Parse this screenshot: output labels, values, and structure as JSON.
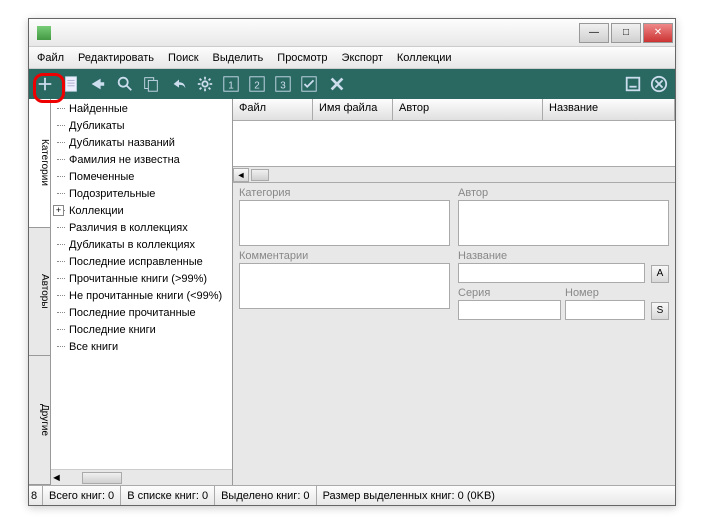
{
  "menubar": [
    "Файл",
    "Редактировать",
    "Поиск",
    "Выделить",
    "Просмотр",
    "Экспорт",
    "Коллекции"
  ],
  "sidetabs": [
    "Категории",
    "Авторы",
    "Другие"
  ],
  "tree": [
    {
      "label": "Найденные",
      "expandable": false
    },
    {
      "label": "Дубликаты",
      "expandable": false
    },
    {
      "label": "Дубликаты названий",
      "expandable": false
    },
    {
      "label": "Фамилия не известна",
      "expandable": false
    },
    {
      "label": "Помеченные",
      "expandable": false
    },
    {
      "label": "Подозрительные",
      "expandable": false
    },
    {
      "label": "Коллекции",
      "expandable": true
    },
    {
      "label": "Различия в коллекциях",
      "expandable": false
    },
    {
      "label": "Дубликаты в коллекциях",
      "expandable": false
    },
    {
      "label": "Последние исправленные",
      "expandable": false
    },
    {
      "label": "Прочитанные книги (>99%)",
      "expandable": false
    },
    {
      "label": "Не прочитанные книги (<99%)",
      "expandable": false
    },
    {
      "label": "Последние прочитанные",
      "expandable": false
    },
    {
      "label": "Последние книги",
      "expandable": false
    },
    {
      "label": "Все книги",
      "expandable": false
    }
  ],
  "grid_columns": [
    "Файл",
    "Имя файла ...",
    "Автор",
    "Название"
  ],
  "form": {
    "category": "Категория",
    "author": "Автор",
    "comments": "Комментарии",
    "title": "Название",
    "series": "Серия",
    "number": "Номер",
    "btn_a": "A",
    "btn_s": "S"
  },
  "status": {
    "c0": "8",
    "c1": "Всего книг: 0",
    "c2": "В списке книг: 0",
    "c3": "Выделено книг: 0",
    "c4": "Размер выделенных книг: 0   (0KB)"
  }
}
